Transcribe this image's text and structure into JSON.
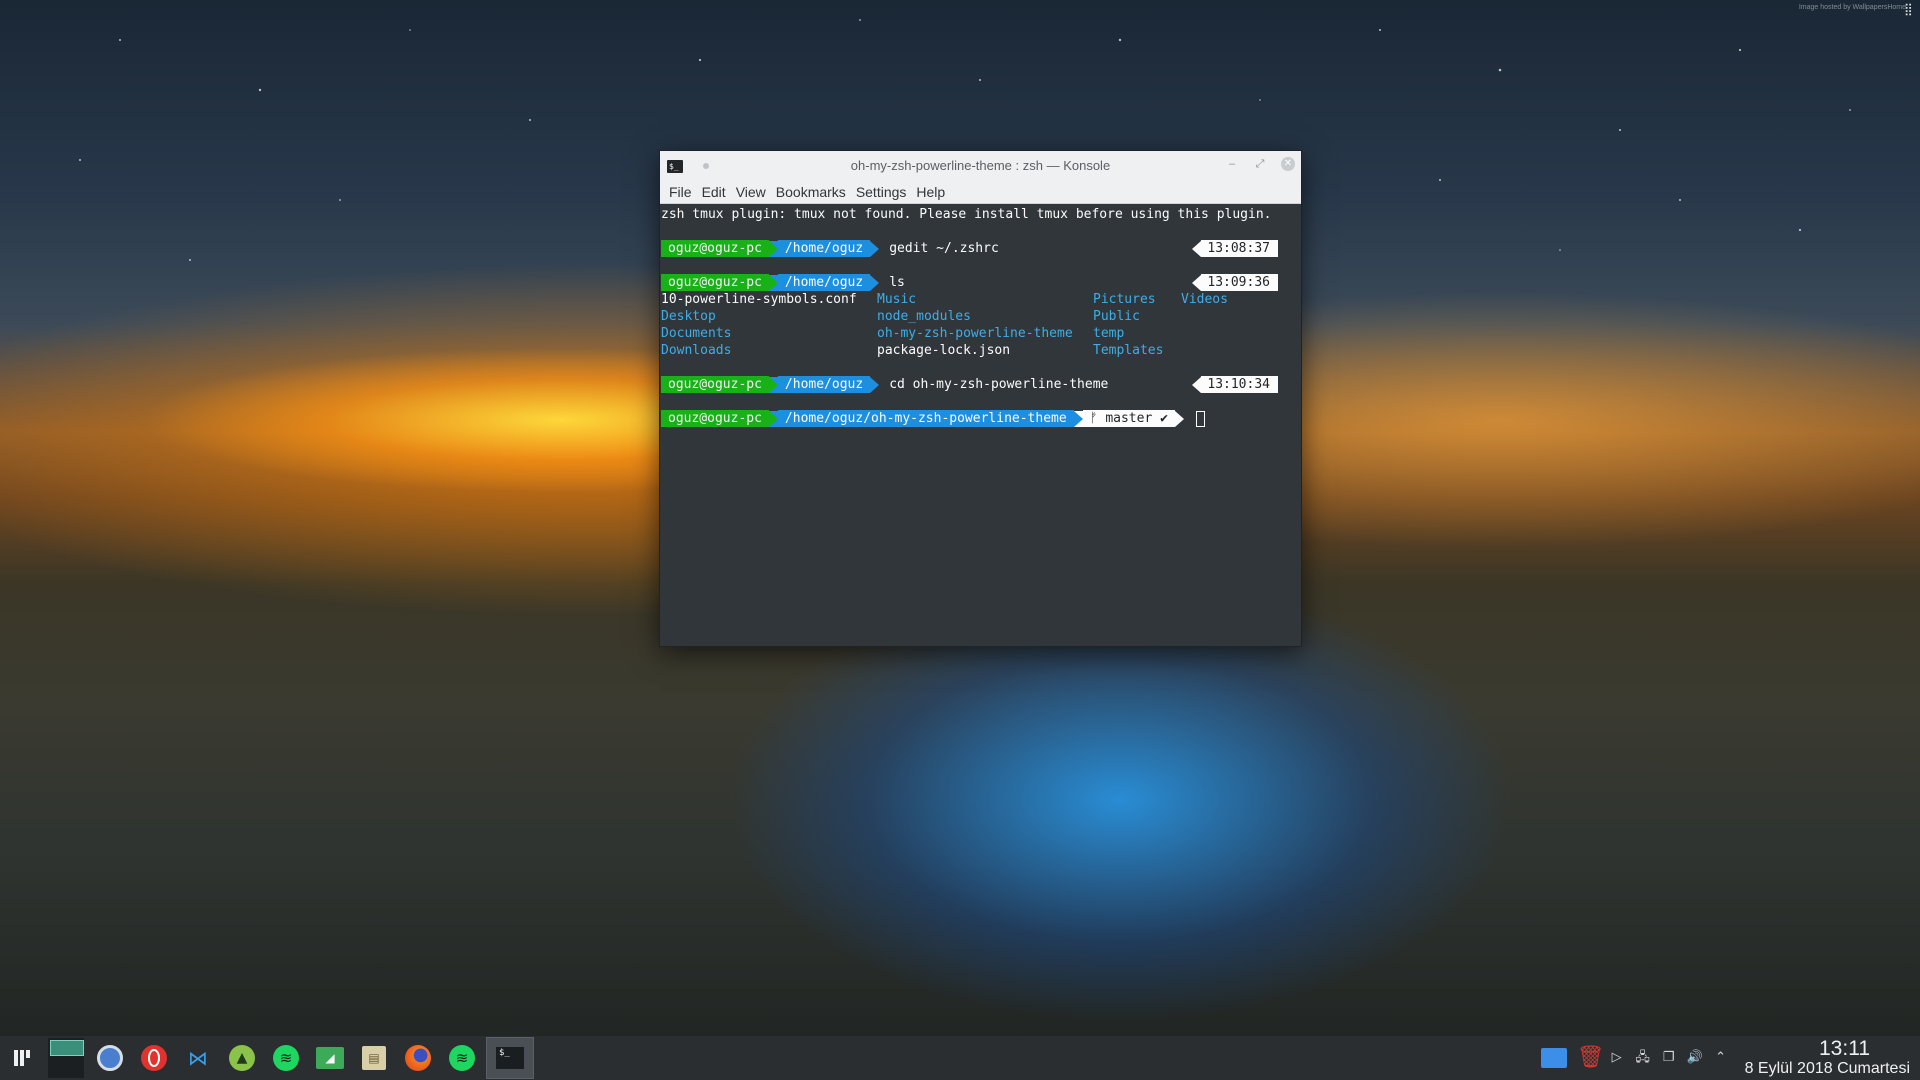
{
  "desktop": {
    "watermark": "Image hosted by WallpapersHome"
  },
  "window": {
    "title": "oh-my-zsh-powerline-theme : zsh — Konsole",
    "menu": [
      "File",
      "Edit",
      "View",
      "Bookmarks",
      "Settings",
      "Help"
    ]
  },
  "terminal": {
    "warning": "zsh tmux plugin: tmux not found. Please install tmux before using this plugin.",
    "prompts": [
      {
        "user": "oguz@oguz-pc",
        "dir": "/home/oguz",
        "command": "gedit ~/.zshrc",
        "time": "13:08:37"
      },
      {
        "user": "oguz@oguz-pc",
        "dir": "/home/oguz",
        "command": "ls",
        "time": "13:09:36"
      },
      {
        "user": "oguz@oguz-pc",
        "dir": "/home/oguz",
        "command": "cd oh-my-zsh-powerline-theme",
        "time": "13:10:34"
      },
      {
        "user": "oguz@oguz-pc",
        "dir": "/home/oguz/oh-my-zsh-powerline-theme",
        "git": "ᚠ master ✔"
      }
    ],
    "ls_output": {
      "col1": [
        "10-powerline-symbols.conf",
        "Desktop",
        "Documents",
        "Downloads"
      ],
      "col2": [
        "Music",
        "node_modules",
        "oh-my-zsh-powerline-theme",
        "package-lock.json"
      ],
      "col3": [
        "Pictures",
        "Public",
        "temp",
        "Templates"
      ],
      "col4": [
        "Videos"
      ]
    },
    "colors": {
      "user_bg": "#18b218",
      "dir_bg": "#1d8fe0",
      "dir_text": "#3daee9"
    }
  },
  "taskbar": {
    "apps": [
      "app-launcher-icon",
      "pager",
      "chromium-icon",
      "opera-icon",
      "vscode-icon",
      "android-studio-icon",
      "spotify-icon",
      "file-manager-icon",
      "archive-icon",
      "firefox-icon",
      "spotify-icon",
      "konsole-icon"
    ],
    "konsole_label": "$_",
    "clock_time": "13:11",
    "clock_date": "8 Eylül 2018 Cumartesi"
  }
}
